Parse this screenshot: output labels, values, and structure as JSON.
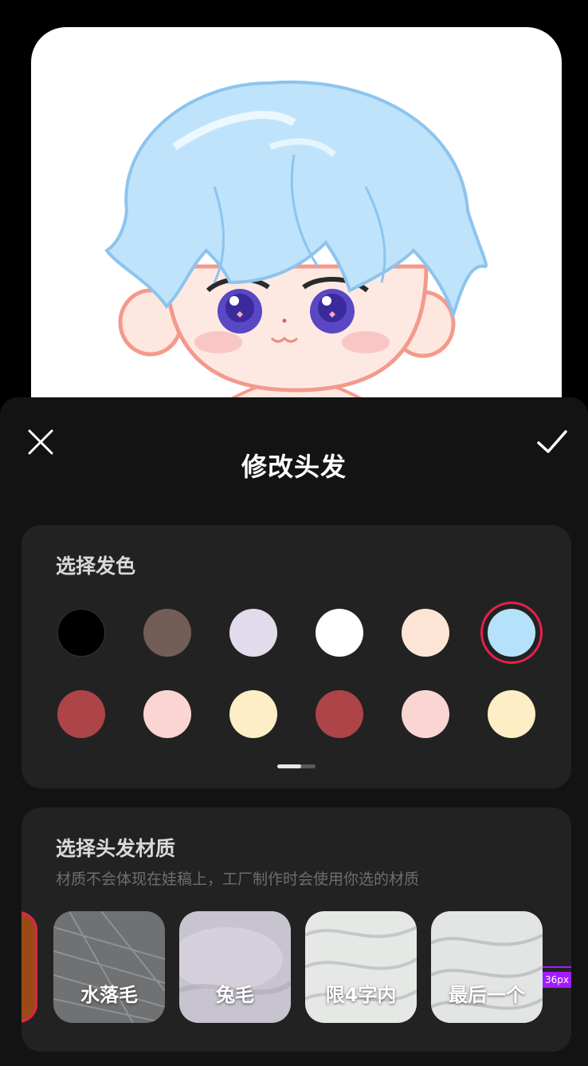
{
  "header": {
    "title": "修改头发"
  },
  "color_section": {
    "title": "选择发色",
    "colors": [
      "#000000",
      "#725e56",
      "#e2dbec",
      "#ffffff",
      "#fde5d6",
      "#b5e2fb",
      "#ac4448",
      "#fbd5d1",
      "#fdeec5",
      "#ac4448",
      "#fbd5d1",
      "#fdeec5"
    ],
    "selected_index": 5
  },
  "material_section": {
    "title": "选择头发材质",
    "subtitle": "材质不会体现在娃稿上，工厂制作时会使用你选的材质",
    "items": [
      {
        "label": "水落毛",
        "color": "#6f7173"
      },
      {
        "label": "兔毛",
        "color": "#c7c3cf"
      },
      {
        "label": "限4字内",
        "color": "#e6e8e6"
      },
      {
        "label": "最后一个",
        "color": "#e3e5e4"
      }
    ]
  },
  "overlay": {
    "badge": "36px"
  }
}
